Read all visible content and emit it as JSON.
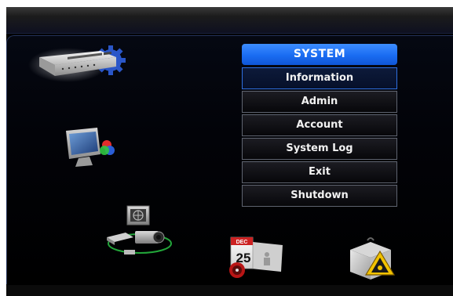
{
  "menu": {
    "title": "SYSTEM",
    "items": [
      {
        "label": "Information",
        "selected": true
      },
      {
        "label": "Admin",
        "selected": false
      },
      {
        "label": "Account",
        "selected": false
      },
      {
        "label": "System Log",
        "selected": false
      },
      {
        "label": "Exit",
        "selected": false
      },
      {
        "label": "Shutdown",
        "selected": false
      }
    ]
  },
  "calendar_icon": {
    "month": "DEC",
    "day": "25"
  },
  "colors": {
    "accent": "#1a6cf2",
    "selected_border": "#2f6fe0",
    "background": "#000000"
  },
  "icons": [
    "dvr-settings-icon",
    "display-color-icon",
    "camera-network-icon",
    "calendar-schedule-icon",
    "alarm-warning-icon"
  ]
}
